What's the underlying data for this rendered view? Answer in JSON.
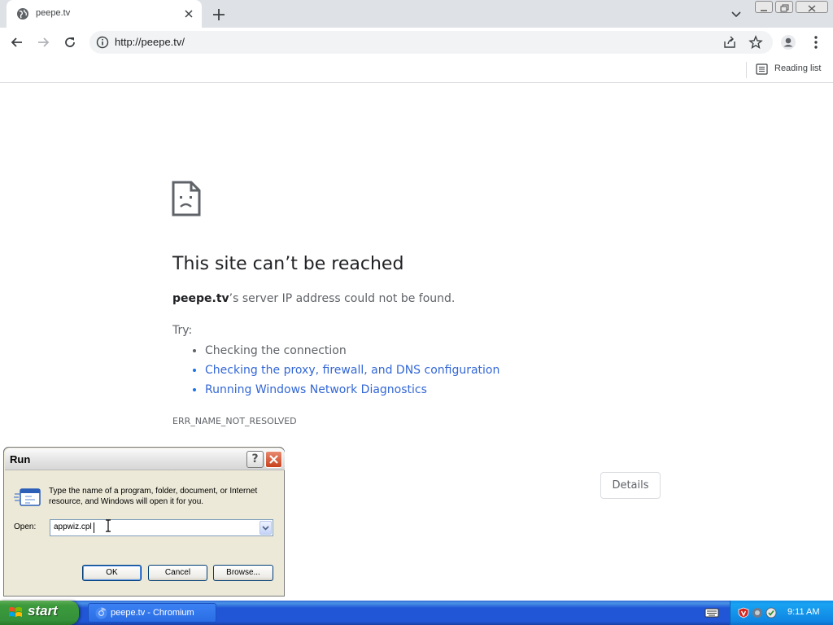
{
  "browser": {
    "tab_title": "peepe.tv",
    "url": "http://peepe.tv/",
    "reading_list_label": "Reading list"
  },
  "error_page": {
    "title": "This site can’t be reached",
    "host": "peepe.tv",
    "message_rest": "’s server IP address could not be found.",
    "try_label": "Try:",
    "suggestions": [
      {
        "text": "Checking the connection",
        "is_link": false
      },
      {
        "text": "Checking the proxy, firewall, and DNS configuration",
        "is_link": true
      },
      {
        "text": "Running Windows Network Diagnostics",
        "is_link": true
      }
    ],
    "error_code": "ERR_NAME_NOT_RESOLVED",
    "details_button": "Details"
  },
  "run_dialog": {
    "title": "Run",
    "help_glyph": "?",
    "description": "Type the name of a program, folder, document, or Internet resource, and Windows will open it for you.",
    "open_label": "Open:",
    "open_value": "appwiz.cpl",
    "ok_label": "OK",
    "cancel_label": "Cancel",
    "browse_label": "Browse..."
  },
  "taskbar": {
    "start_label": "start",
    "task_label": "peepe.tv - Chromium",
    "clock": "9:11 AM"
  },
  "colors": {
    "link": "#3367d6",
    "taskbar_blue": "#2157d7",
    "start_green": "#3c9a3c",
    "dialog_face": "#ece9d8"
  }
}
